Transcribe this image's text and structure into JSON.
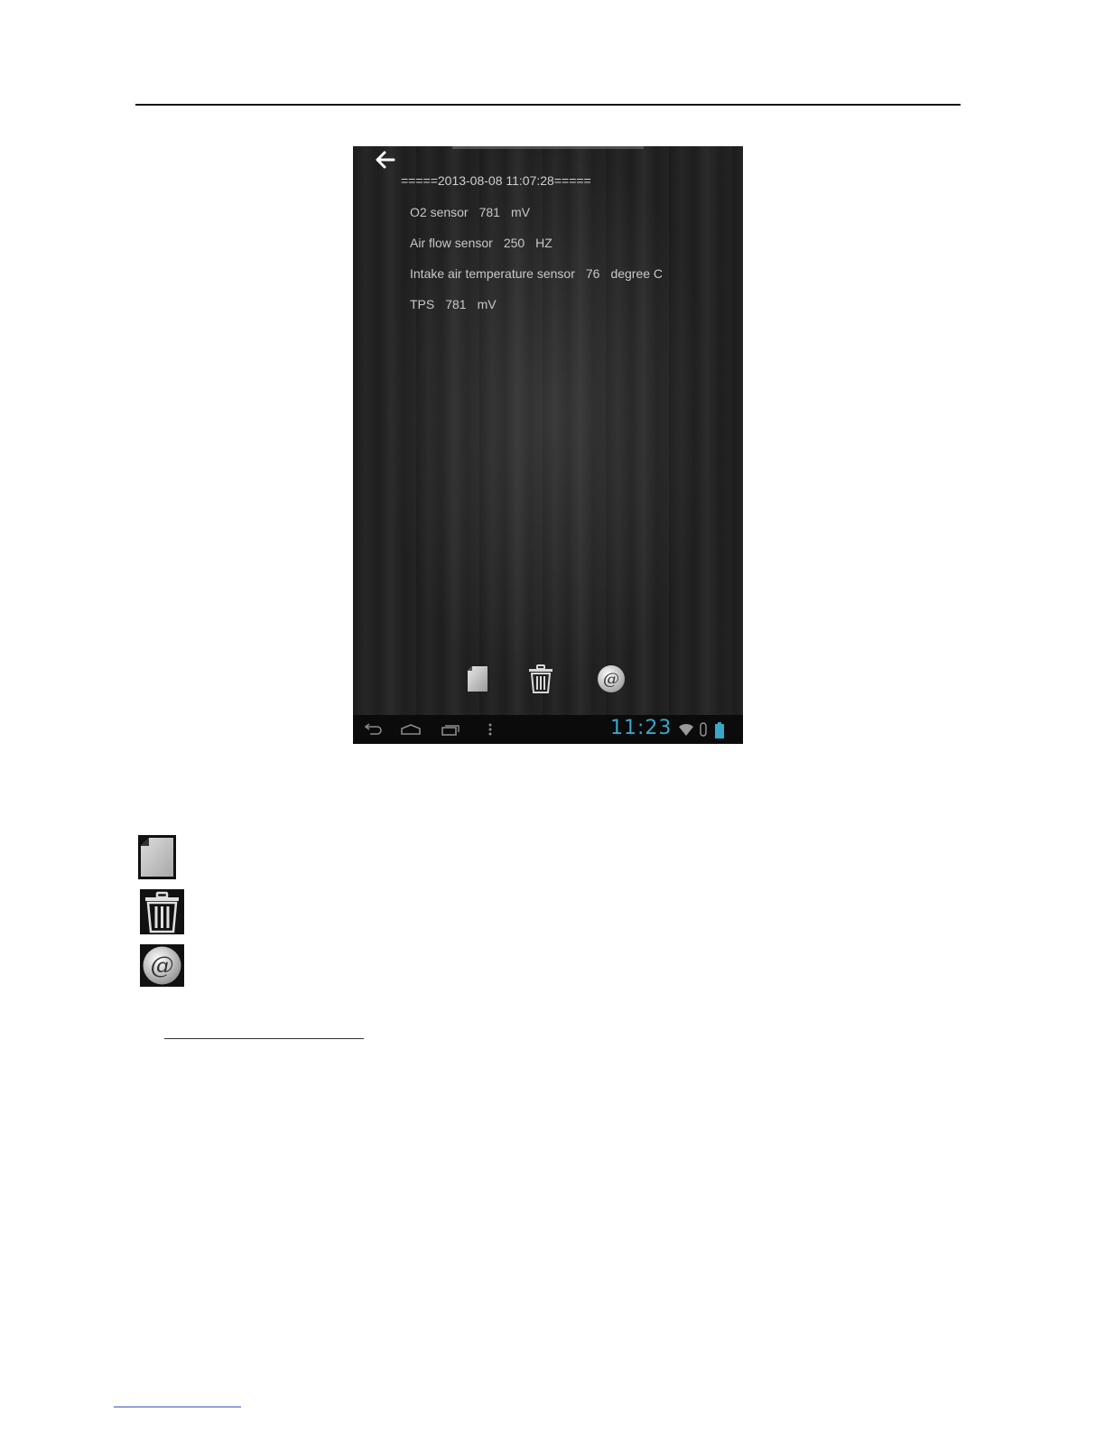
{
  "screen": {
    "timestamp": "=====2013-08-08 11:07:28=====",
    "readings": [
      {
        "name": "O2 sensor",
        "value": "781",
        "unit": "mV"
      },
      {
        "name": "Air flow sensor",
        "value": "250",
        "unit": "HZ"
      },
      {
        "name": "Intake air temperature sensor",
        "value": "76",
        "unit": "degree C"
      },
      {
        "name": "TPS",
        "value": "781",
        "unit": "mV"
      }
    ],
    "actions": [
      {
        "icon": "document-icon"
      },
      {
        "icon": "trash-icon"
      },
      {
        "icon": "email-icon",
        "glyph": "@"
      }
    ],
    "status_bar": {
      "clock": "11:23",
      "clock_color": "#3aa6c9"
    }
  },
  "legend": [
    {
      "icon": "document-icon"
    },
    {
      "icon": "trash-icon"
    },
    {
      "icon": "email-icon",
      "glyph": "@"
    }
  ]
}
